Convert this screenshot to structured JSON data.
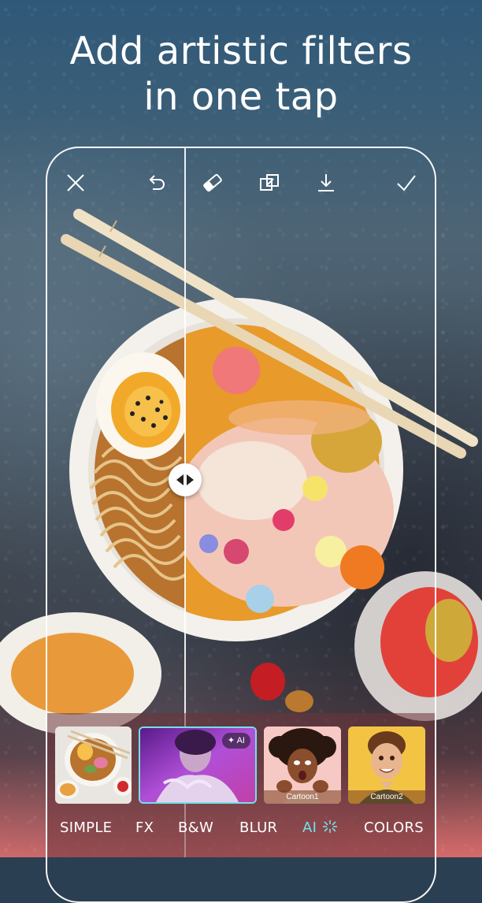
{
  "headline": {
    "line1": "Add artistic filters",
    "line2": "in one tap"
  },
  "toolbar": {
    "icons": [
      "close-icon",
      "undo-icon",
      "eraser-icon",
      "compare-icon",
      "download-icon",
      "checkmark-icon"
    ]
  },
  "filters": {
    "thumbnails": [
      {
        "caption": ""
      },
      {
        "badge": "AI",
        "selected": true
      },
      {
        "caption": "Cartoon1"
      },
      {
        "caption": "Cartoon2"
      }
    ],
    "tabs": [
      {
        "label": "SIMPLE"
      },
      {
        "label": "FX"
      },
      {
        "label": "B&W"
      },
      {
        "label": "BLUR"
      },
      {
        "label": "AI",
        "active": true
      },
      {
        "label": "COLORS"
      }
    ]
  },
  "colors": {
    "accent": "#74e0ea",
    "panel": "#6e343a"
  }
}
